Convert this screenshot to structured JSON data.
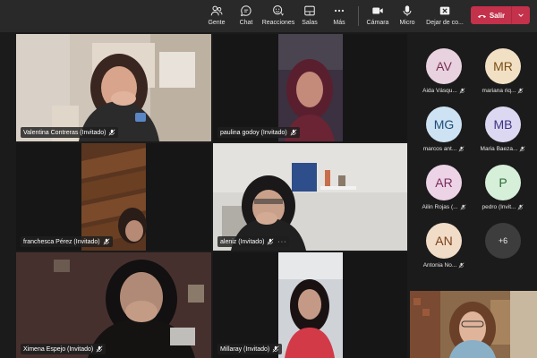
{
  "toolbar": {
    "people_label": "Gente",
    "chat_label": "Chat",
    "reactions_label": "Reacciones",
    "rooms_label": "Salas",
    "more_label": "Más",
    "camera_label": "Cámara",
    "mic_label": "Micro",
    "share_label": "Dejar de co...",
    "leave_label": "Salir"
  },
  "participants": [
    {
      "name": "Valentina Contreras (Invitado)"
    },
    {
      "name": "paulina godoy (Invitado)"
    },
    {
      "name": "franchesca Pérez (Invitado)"
    },
    {
      "name": "aleniz (Invitado)"
    },
    {
      "name": "Ximena Espejo (Invitado)"
    },
    {
      "name": "Millaray (Invitado)"
    }
  ],
  "roster": [
    {
      "initials": "AV",
      "name": "Aida Vásqu...",
      "bg": "#e8d2df",
      "fg": "#7a2e54"
    },
    {
      "initials": "MR",
      "name": "mariana riq...",
      "bg": "#f2e0c4",
      "fg": "#7a4e14"
    },
    {
      "initials": "MG",
      "name": "marcos ant...",
      "bg": "#cde2f2",
      "fg": "#1f4e79"
    },
    {
      "initials": "MB",
      "name": "Maria Baeza...",
      "bg": "#dcd8f2",
      "fg": "#3c3483"
    },
    {
      "initials": "AR",
      "name": "Ailin Rojas (...",
      "bg": "#ecd3e6",
      "fg": "#7a2a5e"
    },
    {
      "initials": "P",
      "name": "pedro (Invit...",
      "bg": "#d6efd9",
      "fg": "#2d6b36"
    },
    {
      "initials": "AN",
      "name": "Antonia No...",
      "bg": "#f1dcc8",
      "fg": "#7a3f14"
    }
  ],
  "overflow_count": "+6",
  "icons": [
    "people-icon",
    "chat-icon",
    "reactions-icon",
    "rooms-icon",
    "more-icon",
    "camera-icon",
    "mic-icon",
    "share-stop-icon",
    "phone-icon",
    "chevron-down-icon",
    "mic-off-icon"
  ],
  "colors": {
    "leave": "#c4314b",
    "toolbar": "#292929",
    "stage": "#1b1b1b"
  }
}
